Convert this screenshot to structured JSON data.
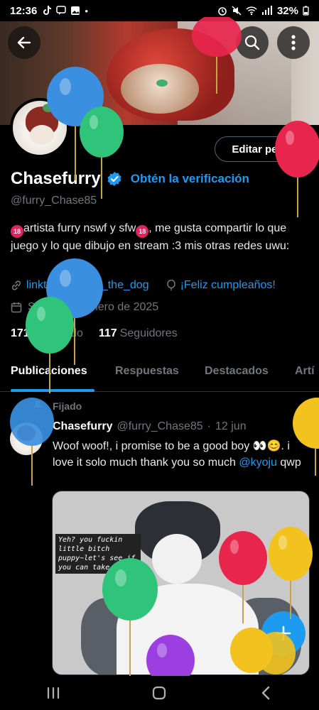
{
  "status_bar": {
    "time": "12:36",
    "battery": "32%"
  },
  "profile": {
    "name": "Chasefurry",
    "verify_cta": "Obtén la verificación",
    "handle": "@furry_Chase85",
    "edit_label": "Editar perfil",
    "bio_part1": "artista furry nswf y sfw",
    "bio_part2": ", me gusta compartir lo que juego y lo que dibujo en stream :3  mis otras redes uwu:",
    "badge_text": "18",
    "link": "linktr.ee/Chase_the_dog",
    "birthday": "¡Feliz cumpleaños!",
    "joined": "Se unió en enero de 2025",
    "following_count": "171",
    "following_label": "Siguiendo",
    "followers_count": "117",
    "followers_label": "Seguidores"
  },
  "tabs": [
    {
      "label": "Publicaciones",
      "active": true
    },
    {
      "label": "Respuestas",
      "active": false
    },
    {
      "label": "Destacados",
      "active": false
    },
    {
      "label": "Artí",
      "active": false
    }
  ],
  "post": {
    "pinned_label": "Fijado",
    "author": "Chasefurry",
    "handle": "@furry_Chase85",
    "dot": "·",
    "date": "12 jun",
    "text": "Woof woof!, i promise to be a good boy 👀😊. i love it solo much thank you so much",
    "mention": "@kyoju",
    "text_end": "qwp",
    "image_caption": "Yeh? you fuckin little bitch puppy~let's see if you can take me"
  },
  "colors": {
    "accent": "#1d9bf0",
    "background": "#000000",
    "muted": "#71767b",
    "balloon_blue": "#3a8fe0",
    "balloon_green": "#2fc47a",
    "balloon_red": "#e8264d",
    "balloon_yellow": "#f2c21e",
    "balloon_purple": "#9b3fe0"
  },
  "icons": {
    "back": "arrow-left-icon",
    "search": "search-icon",
    "more": "more-vertical-icon",
    "verified": "verified-badge-icon",
    "link": "link-icon",
    "birthday": "balloon-icon",
    "calendar": "calendar-icon",
    "pin": "pin-icon",
    "compose": "plus-icon"
  }
}
